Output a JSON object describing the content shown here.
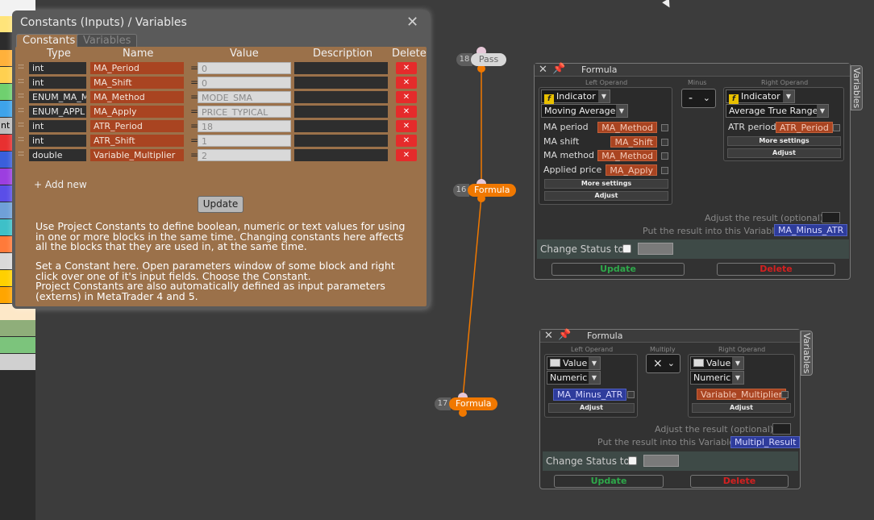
{
  "left_strip": {
    "partial_label": "nt",
    "colors": [
      "#f2f2f2",
      "#ffe47a",
      "#ffb13b",
      "#ffd050",
      "#6fd06f",
      "#3ea3ea",
      "#bdbdbd",
      "#e83030",
      "#3a5fdb",
      "#9c3ee0",
      "#5a4ee8",
      "#6fa0d8",
      "#3ec0c8",
      "#ff7a3a",
      "#d9d9d9",
      "#ffd000",
      "#ffa500",
      "#fde8c8",
      "#8fae7a",
      "#7cc47c",
      "#d0d0d0"
    ]
  },
  "constants_window": {
    "title": "Constants (Inputs) / Variables",
    "tabs": [
      "Constants",
      "Variables"
    ],
    "columns": {
      "type": "Type",
      "name": "Name",
      "value": "Value",
      "description": "Description",
      "delete": "Delete"
    },
    "rows": [
      {
        "type": "int",
        "name": "MA_Period",
        "value": "0"
      },
      {
        "type": "int",
        "name": "MA_Shift",
        "value": "0"
      },
      {
        "type": "ENUM_MA_M",
        "name": "MA_Method",
        "value": "MODE_SMA"
      },
      {
        "type": "ENUM_APPL",
        "name": "MA_Apply",
        "value": "PRICE_TYPICAL"
      },
      {
        "type": "int",
        "name": "ATR_Period",
        "value": "18"
      },
      {
        "type": "int",
        "name": "ATR_Shift",
        "value": "1"
      },
      {
        "type": "double",
        "name": "Variable_Multiplier",
        "value": "2"
      }
    ],
    "drag_glyph": ":::",
    "equals": "=",
    "delete_glyph": "✕",
    "add_new": "+ Add new",
    "update": "Update",
    "help_1": "Use Project Constants to define boolean, numeric or text values for using in one or more blocks in the same time. Changing constants here affects all the blocks that they are used in, at the same time.",
    "help_2": "Set a Constant here. Open parameters window of some block and right click over one of it's input fields. Choose the Constant.",
    "help_3": "Project Constants are also automatically defined as input parameters (externs) in MetaTrader 4 and 5."
  },
  "nodes": [
    {
      "num": "18",
      "label": "Pass"
    },
    {
      "num": "16",
      "label": "Formula"
    },
    {
      "num": "17",
      "label": "Formula"
    }
  ],
  "formula1": {
    "title": "Formula",
    "side_tab": "Variables",
    "left_caption": "Left Operand",
    "op_caption": "Minus",
    "op_value": "-",
    "right_caption": "Right Operand",
    "left_kind": "Indicator",
    "left_indicator": "Moving Average",
    "left_params": [
      {
        "label": "MA period",
        "const": "MA_Method"
      },
      {
        "label": "MA shift",
        "const": "MA_Shift"
      },
      {
        "label": "MA method",
        "const": "MA_Method"
      },
      {
        "label": "Applied price",
        "const": "MA_Apply"
      }
    ],
    "more_settings": "More settings",
    "adjust": "Adjust",
    "right_kind": "Indicator",
    "right_indicator": "Average True Range",
    "right_params": [
      {
        "label": "ATR period",
        "const": "ATR_Period"
      }
    ],
    "adjust_result": "Adjust the result (optional):",
    "put_result": "Put the result into this Variable:",
    "result_var": "MA_Minus_ATR",
    "change_status": "Change Status to",
    "update": "Update",
    "delete": "Delete"
  },
  "formula2": {
    "title": "Formula",
    "side_tab": "Variables",
    "left_caption": "Left Operand",
    "op_caption": "Multiply",
    "op_value": "×",
    "right_caption": "Right Operand",
    "left_kind": "Value",
    "left_type": "Numeric",
    "left_var": "MA_Minus_ATR",
    "right_kind": "Value",
    "right_type": "Numeric",
    "right_const": "Variable_Multiplier",
    "adjust": "Adjust",
    "adjust_result": "Adjust the result (optional):",
    "put_result": "Put the result into this Variable:",
    "result_var": "Multipl_Result",
    "change_status": "Change Status to",
    "update": "Update",
    "delete": "Delete"
  },
  "colors": {
    "node_orange": "#f07800",
    "link": "#ff9a3a",
    "panel_bg": "#9b714a"
  }
}
